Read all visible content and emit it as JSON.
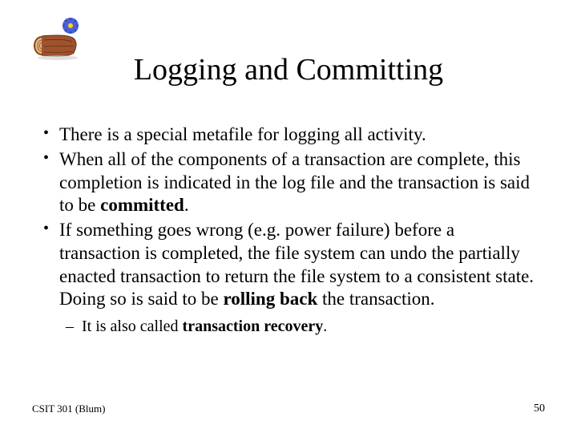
{
  "title": "Logging and Committing",
  "bullets": {
    "b1": "There is a special metafile for logging all activity.",
    "b2_p1": "When all of the components of a transaction are complete, this completion is indicated in the log file and the transaction is said to be ",
    "b2_bold": "committed",
    "b2_p2": ".",
    "b3_p1": "If something goes wrong (e.g. power failure) before a transaction is completed, the file system can undo the partially enacted transaction to return the file system to a consistent state.  Doing so is said to be ",
    "b3_bold": "rolling back",
    "b3_p2": " the transaction."
  },
  "sub": {
    "s1_p1": "It is also called ",
    "s1_bold": "transaction recovery",
    "s1_p2": "."
  },
  "footer": {
    "left": "CSIT 301 (Blum)",
    "page": "50"
  }
}
